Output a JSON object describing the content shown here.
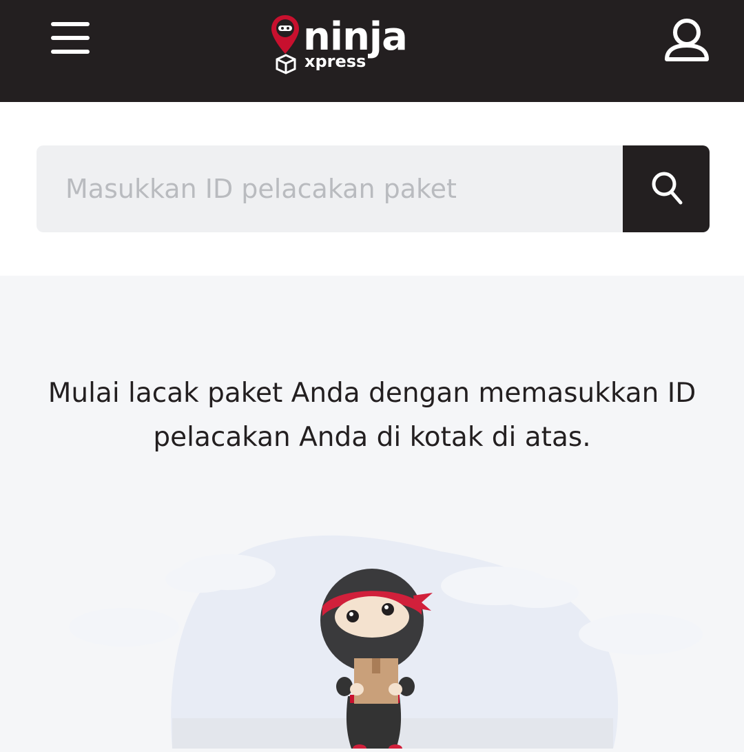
{
  "header": {
    "menu_icon": "hamburger-menu-icon",
    "logo_word": "ninja",
    "logo_sub": "xpress",
    "user_icon": "user-account-icon",
    "background_color": "#231f20",
    "brand_red": "#c8102e"
  },
  "search": {
    "placeholder": "Masukkan ID pelacakan paket",
    "value": "",
    "button_icon": "search-icon"
  },
  "main": {
    "message": "Mulai lacak paket Anda dengan memasukkan ID pelacakan Anda di kotak di atas.",
    "illustration": "ninja-holding-parcel-illustration"
  }
}
